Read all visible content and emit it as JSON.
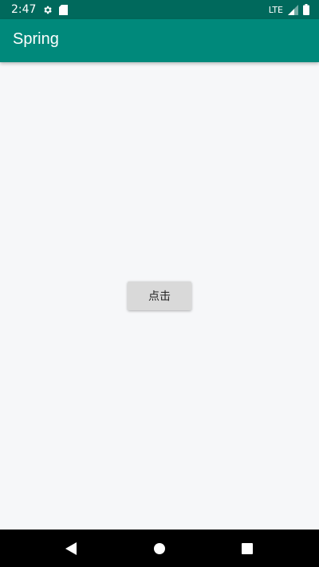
{
  "status_bar": {
    "time": "2:47",
    "network": "LTE",
    "icons": [
      "gear-icon",
      "sd-card-icon",
      "signal-icon",
      "battery-icon"
    ],
    "background": "#00695c"
  },
  "app_bar": {
    "title": "Spring",
    "background": "#00897b"
  },
  "main": {
    "button_label": "点击",
    "background": "#f6f7f9"
  },
  "nav_bar": {
    "buttons": [
      "back-icon",
      "home-icon",
      "recents-icon"
    ],
    "background": "#000000"
  }
}
